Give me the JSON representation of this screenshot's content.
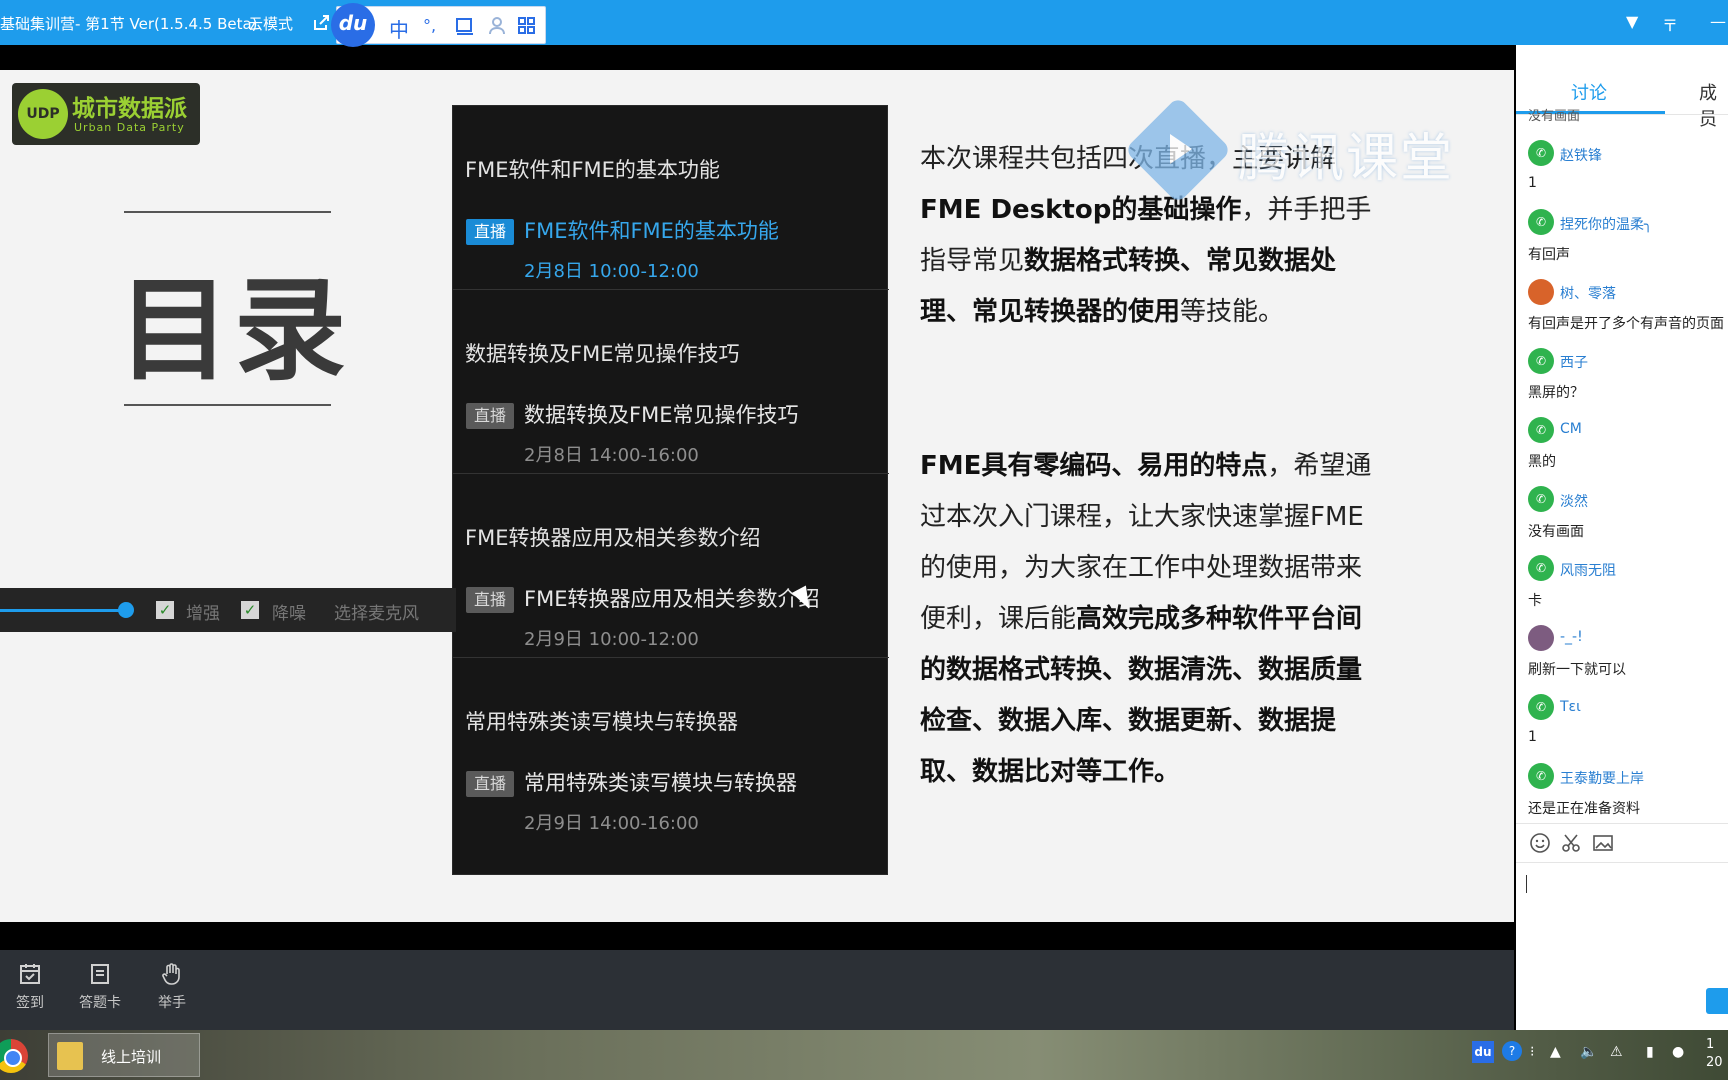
{
  "window": {
    "title": "基础集训营- 第1节 Ver(1.5.4.5 Beta)",
    "mode": "云模式"
  },
  "ime": {
    "logo": "du",
    "chinese": "中",
    "punct": "°,",
    "mode_icon": "keyboard-icon",
    "user_icon": "user-icon",
    "grid_icon": "grid-icon"
  },
  "slide": {
    "logo_text": "城市数据派",
    "logo_sub": "Urban Data Party",
    "logo_mark": "UDP",
    "heading": "目录",
    "watermark": "腾讯课堂",
    "sections": [
      {
        "title": "FME软件和FME的基本功能",
        "badge": "直播",
        "item": "FME软件和FME的基本功能",
        "time": "2月8日 10:00-12:00",
        "active": true
      },
      {
        "title": "数据转换及FME常见操作技巧",
        "badge": "直播",
        "item": "数据转换及FME常见操作技巧",
        "time": "2月8日 14:00-16:00",
        "active": false
      },
      {
        "title": "FME转换器应用及相关参数介绍",
        "badge": "直播",
        "item": "FME转换器应用及相关参数介绍",
        "time": "2月9日 10:00-12:00",
        "active": false
      },
      {
        "title": "常用特殊类读写模块与转换器",
        "badge": "直播",
        "item": "常用特殊类读写模块与转换器",
        "time": "2月9日 14:00-16:00",
        "active": false
      }
    ],
    "para1_plain1": "本次课程共包括四次直播，主要讲解",
    "para1_bold1": "FME Desktop的基础操作",
    "para1_plain2": "，并手把手指导常见",
    "para1_bold2": "数据格式转换、常见数据处理、常见转换器的使用",
    "para1_plain3": "等技能。",
    "para2_bold1": "FME具有零编码、易用的特点",
    "para2_plain1": "，希望通过本次入门课程，让大家快速掌握FME的使用，为大家在工作中处理数据带来便利，课后能",
    "para2_bold2": "高效完成多种软件平台间的数据格式转换、数据清洗、数据质量检查、数据入库、数据更新、数据提取、数据比对等工作。"
  },
  "micbar": {
    "enhance_label": "增强",
    "denoise_label": "降噪",
    "select_mic": "选择麦克风",
    "level": 0.9
  },
  "toolbar": {
    "signin": "签到",
    "answer_card": "答题卡",
    "raise_hand": "举手"
  },
  "side": {
    "tab_discuss": "讨论",
    "tab_members": "成员",
    "clipped_msg": "没有画面",
    "messages": [
      {
        "user": "赵铁锋",
        "text": "1",
        "avatar": "wechat-icon"
      },
      {
        "user": "捏死你的温柔╮",
        "text": "有回声",
        "avatar": "wechat-icon"
      },
      {
        "user": "树、零落",
        "text": "有回声是开了多个有声音的页面",
        "avatar": "fire-avatar"
      },
      {
        "user": "西子",
        "text": "黑屏的？",
        "avatar": "wechat-icon"
      },
      {
        "user": "CM",
        "text": "黑的",
        "avatar": "wechat-icon"
      },
      {
        "user": "淡然",
        "text": "没有画面",
        "avatar": "wechat-icon"
      },
      {
        "user": "风雨无阻",
        "text": "卡",
        "avatar": "wechat-icon"
      },
      {
        "user": "-_-!",
        "text": "刷新一下就可以",
        "avatar": "photo-avatar"
      },
      {
        "user": "Tει",
        "text": "1",
        "avatar": "wechat-icon"
      },
      {
        "user": "王泰勤要上岸",
        "text": "还是正在准备资料",
        "avatar": "wechat-icon"
      }
    ]
  },
  "taskbar": {
    "task_label": "线上培训",
    "clock_line1": "1",
    "clock_line2": "20"
  }
}
